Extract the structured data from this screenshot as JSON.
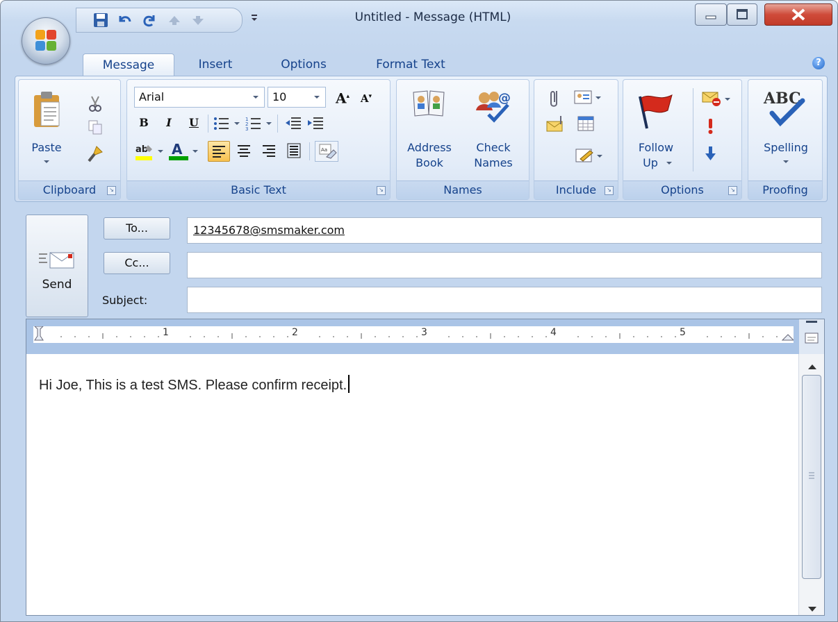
{
  "window": {
    "title": "Untitled - Message (HTML)"
  },
  "tabs": [
    {
      "label": "Message",
      "active": true
    },
    {
      "label": "Insert",
      "active": false
    },
    {
      "label": "Options",
      "active": false
    },
    {
      "label": "Format Text",
      "active": false
    }
  ],
  "ribbon": {
    "clipboard": {
      "label": "Clipboard",
      "paste": "Paste"
    },
    "basic_text": {
      "label": "Basic Text",
      "font": "Arial",
      "size": "10",
      "bold": "B",
      "italic": "I",
      "underline": "U"
    },
    "names": {
      "label": "Names",
      "address_book_1": "Address",
      "address_book_2": "Book",
      "check_names_1": "Check",
      "check_names_2": "Names"
    },
    "include": {
      "label": "Include"
    },
    "options": {
      "label": "Options",
      "follow_up_1": "Follow",
      "follow_up_2": "Up"
    },
    "proofing": {
      "label": "Proofing",
      "spelling": "Spelling",
      "abc": "ABC"
    }
  },
  "header": {
    "send_label": "Send",
    "to_button": "To...",
    "cc_button": "Cc...",
    "subject_label": "Subject:",
    "to_value": "12345678@smsmaker.com",
    "cc_value": "",
    "subject_value": ""
  },
  "ruler_numbers": [
    "1",
    "2",
    "3",
    "4",
    "5"
  ],
  "body": {
    "text": "Hi Joe, This is a test SMS. Please confirm receipt."
  },
  "colors": {
    "accent": "#15428b",
    "ribbon_bg": "#dbe7f6",
    "close_button": "#cf4b3a",
    "highlight_yellow": "#ffff00",
    "font_color_green": "#00a000"
  }
}
